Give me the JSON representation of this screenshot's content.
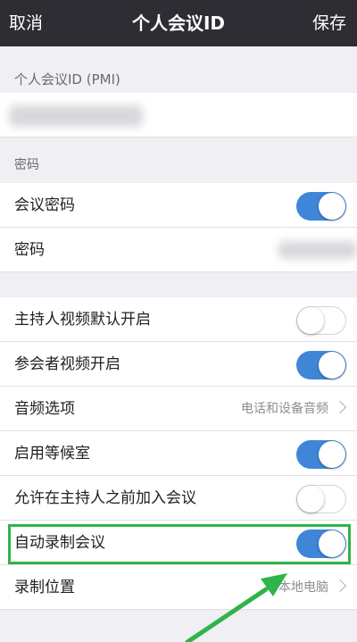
{
  "navbar": {
    "cancel_label": "取消",
    "title": "个人会议ID",
    "save_label": "保存"
  },
  "pmi_section": {
    "header": "个人会议ID (PMI)"
  },
  "password_section": {
    "header": "密码",
    "rows": [
      {
        "label": "会议密码",
        "toggle": "on"
      },
      {
        "label": "密码"
      }
    ]
  },
  "options_section": {
    "rows": [
      {
        "label": "主持人视频默认开启",
        "toggle": "off"
      },
      {
        "label": "参会者视频开启",
        "toggle": "on"
      },
      {
        "label": "音频选项",
        "value": "电话和设备音频"
      },
      {
        "label": "启用等候室",
        "toggle": "on"
      },
      {
        "label": "允许在主持人之前加入会议",
        "toggle": "off"
      },
      {
        "label": "自动录制会议",
        "toggle": "on"
      },
      {
        "label": "录制位置",
        "value": "本地电脑"
      }
    ]
  },
  "colors": {
    "navbar_bg": "#2d2d33",
    "toggle_on": "#3f86d8",
    "highlight": "#2fb34a"
  },
  "icons": {
    "chevron": "chevron-right-icon",
    "arrow": "green-arrow-annotation"
  }
}
